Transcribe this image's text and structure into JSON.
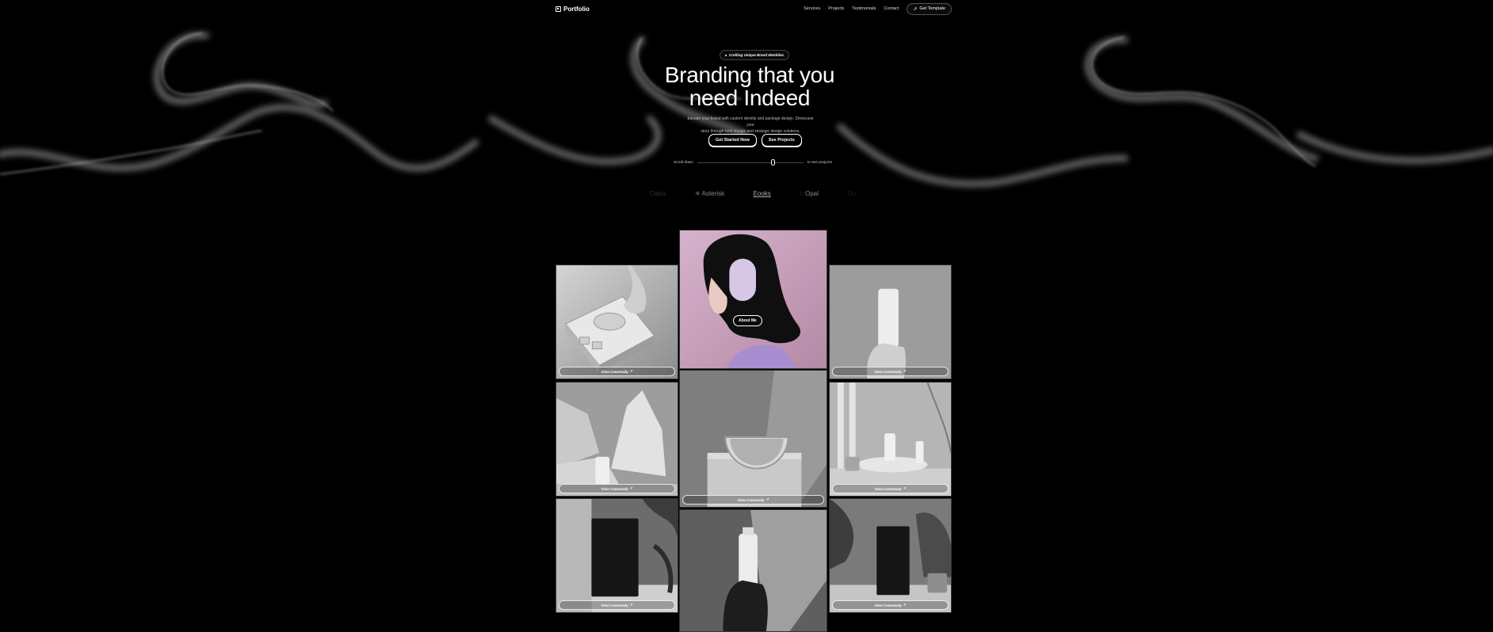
{
  "nav": {
    "brand": "Portfolio",
    "links": [
      "Services",
      "Projects",
      "Testimonials",
      "Contact"
    ],
    "cta": "Get Template"
  },
  "hero": {
    "pill": "Crafting Unique Brand Identities",
    "title_line1": "Branding that you",
    "title_line2": "need Indeed",
    "subtitle_line1": "Elevate your brand with custom identity and package design. Showcase your",
    "subtitle_line2": "story through bold visuals and strategic design solutions.",
    "primary_button": "Get Started Now",
    "secondary_button": "See Projects",
    "scroll_left": "Scroll down",
    "scroll_right": "to see projects"
  },
  "logos": [
    "Oasis",
    "Asterisk",
    "Eooks",
    "Opal",
    "Oo"
  ],
  "gallery": {
    "case_study_label": "View Casestudy",
    "arrow": "↗",
    "about_label": "About Me"
  },
  "colors": {
    "background": "#000000",
    "accent_portrait": "#c9a5c0"
  },
  "icons": [
    "portfolio-logo-icon",
    "template-icon",
    "mouse-icon",
    "arrow-up-right-icon"
  ]
}
